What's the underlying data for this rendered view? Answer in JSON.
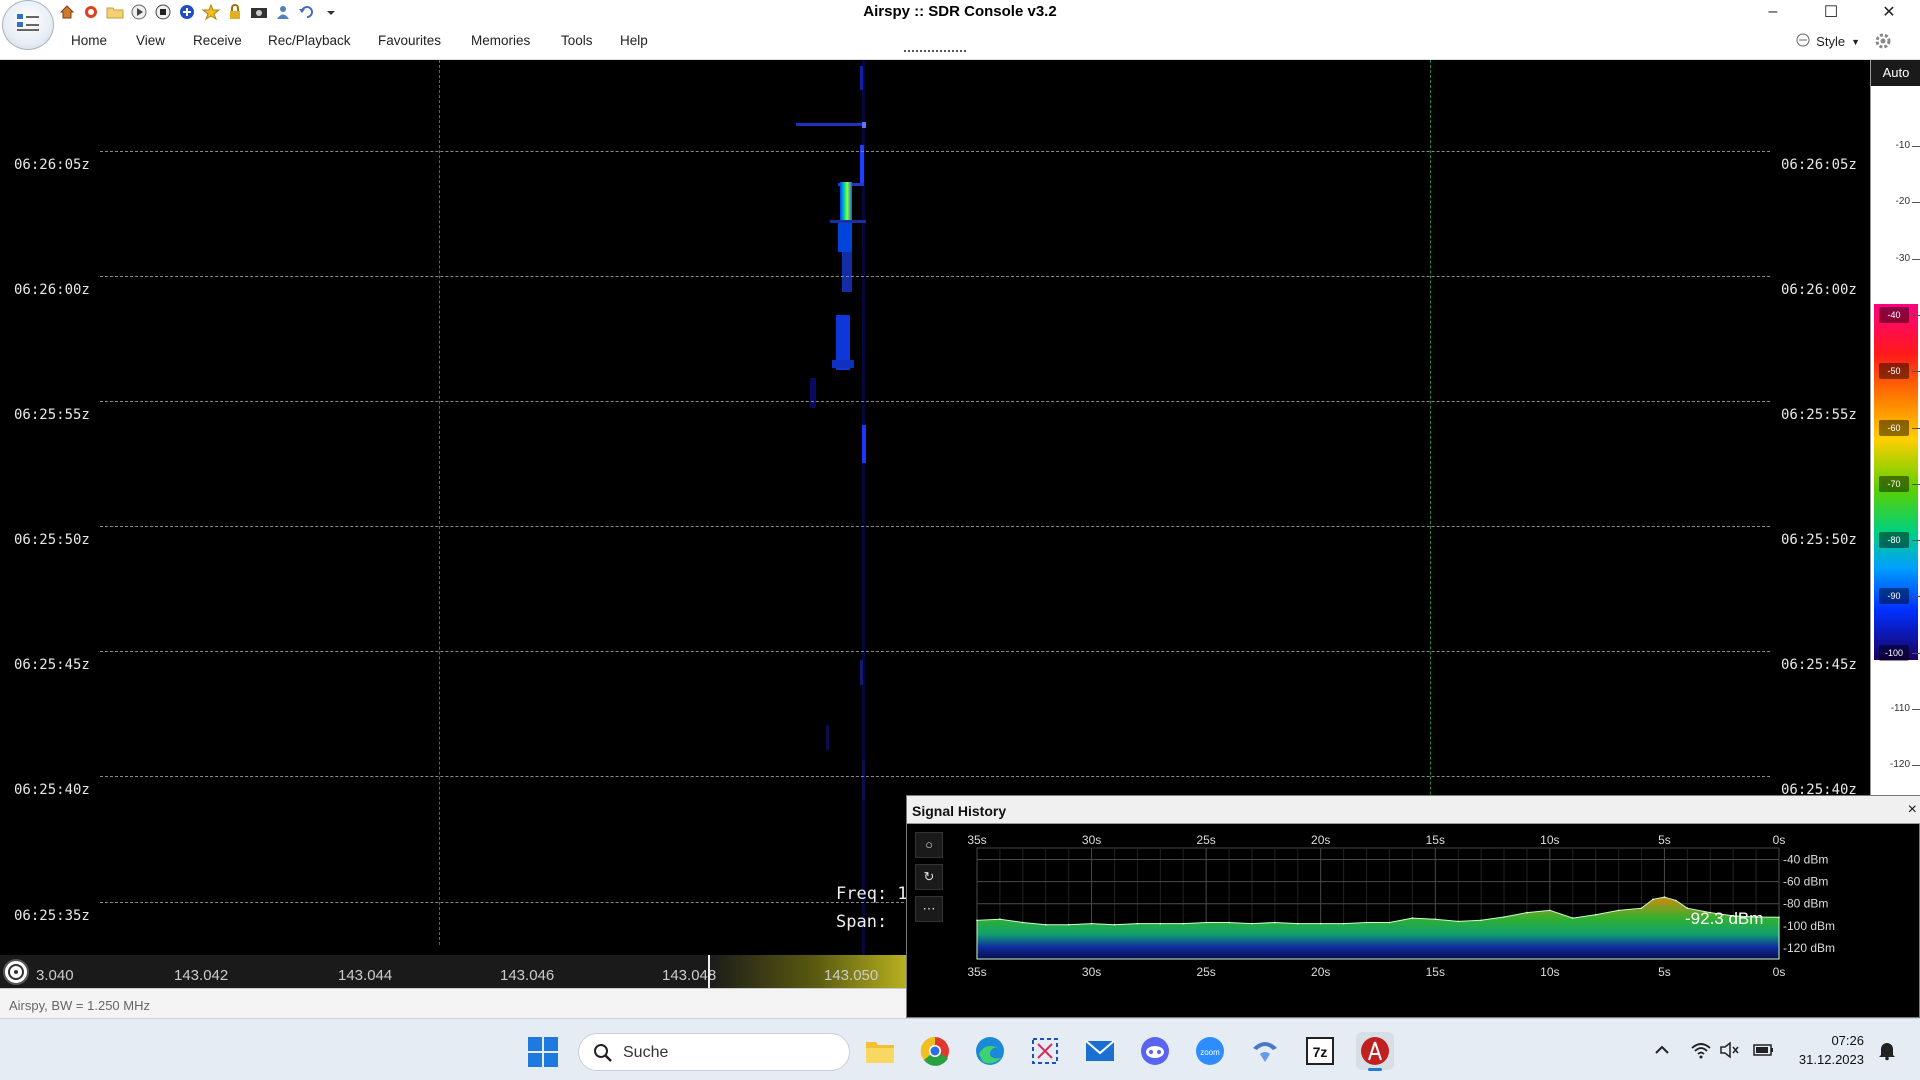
{
  "window": {
    "title": "Airspy :: SDR Console v3.2"
  },
  "quick_access": [
    "home-icon",
    "lifebuoy-icon",
    "folder-icon",
    "play-icon",
    "stop-icon",
    "add-icon",
    "star-icon",
    "lock-icon",
    "camera-icon",
    "user-icon",
    "undo-icon",
    "dropdown-icon"
  ],
  "ribbon": {
    "tabs": [
      "Home",
      "View",
      "Receive",
      "Rec/Playback",
      "Favourites",
      "Memories",
      "Tools",
      "Help"
    ],
    "style_label": "Style"
  },
  "waterfall": {
    "time_labels": [
      "06:26:05z",
      "06:26:00z",
      "06:25:55z",
      "06:25:50z",
      "06:25:45z",
      "06:25:40z",
      "06:25:35z"
    ],
    "freq_readout": {
      "freq_label": "Freq: 1",
      "span_label": "Span:"
    }
  },
  "dbm_scale": {
    "auto_label": "Auto",
    "labels": [
      "-10",
      "-20",
      "-30",
      "-40",
      "-50",
      "-60",
      "-70",
      "-80",
      "-90",
      "-100",
      "-110",
      "-120"
    ]
  },
  "frequency_axis": {
    "labels": [
      "3.040",
      "143.042",
      "143.044",
      "143.046",
      "143.048",
      "143.050"
    ]
  },
  "status": {
    "text": "Airspy, BW = 1.250 MHz"
  },
  "signal_history": {
    "title": "Signal History",
    "close_label": "×",
    "buttons": [
      "○",
      "↻",
      "⋯"
    ],
    "readout": "-92.3 dBm"
  },
  "chart_data": {
    "type": "area",
    "title": "Signal History",
    "xlabel": "",
    "ylabel": "",
    "x_ticks": [
      "35s",
      "30s",
      "25s",
      "20s",
      "15s",
      "10s",
      "5s",
      "0s"
    ],
    "y_ticks": [
      "-40 dBm",
      "-60 dBm",
      "-80 dBm",
      "-100 dBm",
      "-120 dBm"
    ],
    "xlim": [
      35,
      0
    ],
    "ylim": [
      -130,
      -35
    ],
    "grid": true,
    "series": [
      {
        "x": [
          35,
          34,
          33,
          32,
          31,
          30,
          29,
          28,
          27,
          26,
          25,
          24,
          23,
          22,
          21,
          20,
          19,
          18,
          17,
          16,
          15,
          14,
          13,
          12,
          11,
          10,
          9,
          8,
          7,
          6,
          5.5,
          5,
          4.5,
          4,
          3,
          2,
          1,
          0
        ],
        "values": [
          -95,
          -94,
          -97,
          -99,
          -99,
          -98,
          -99,
          -98,
          -98,
          -98,
          -97,
          -97,
          -98,
          -97,
          -98,
          -98,
          -98,
          -97,
          -97,
          -93,
          -94,
          -96,
          -95,
          -92,
          -88,
          -86,
          -93,
          -90,
          -86,
          -84,
          -76,
          -74,
          -77,
          -84,
          -88,
          -91,
          -92,
          -92.3
        ]
      }
    ]
  },
  "taskbar": {
    "search_placeholder": "Suche",
    "apps": [
      "file-explorer-icon",
      "chrome-icon",
      "edge-icon",
      "snipping-tool-icon",
      "mail-icon",
      "discord-icon",
      "zoom-icon",
      "remote-icon",
      "7zip-icon",
      "sdr-console-icon"
    ],
    "app_labels": {
      "zoom": "zoom",
      "sevenzip": "7z"
    },
    "time": "07:26",
    "date": "31.12.2023"
  },
  "colors": {
    "waterfall_bg": "#000000",
    "grid_line": "#8a8a8a",
    "marker_line": "#2a8a2a",
    "chart_fill_low": "#10208a",
    "chart_fill_mid": "#1fa83a",
    "chart_fill_high": "#c08a10"
  }
}
